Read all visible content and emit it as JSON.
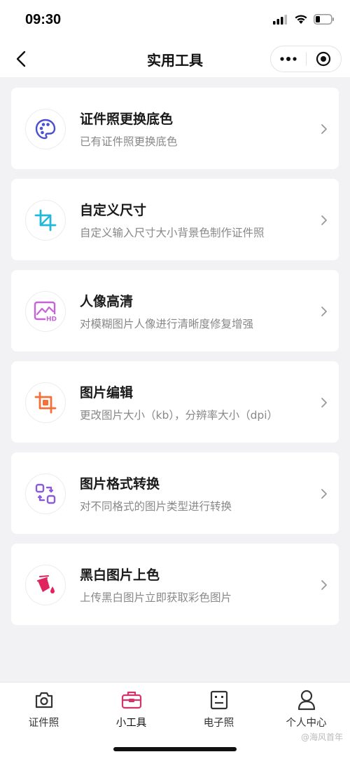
{
  "status_bar": {
    "time": "09:30"
  },
  "nav": {
    "title": "实用工具"
  },
  "tools": [
    {
      "title": "证件照更换底色",
      "desc": "已有证件照更换底色",
      "icon": "palette-icon",
      "color": "#4b4fd1"
    },
    {
      "title": "自定义尺寸",
      "desc": "自定义输入尺寸大小背景色制作证件照",
      "icon": "crop-icon",
      "color": "#22b8d8"
    },
    {
      "title": "人像高清",
      "desc": "对模糊图片人像进行清晰度修复增强",
      "icon": "hd-image-icon",
      "color": "#c763d8"
    },
    {
      "title": "图片编辑",
      "desc": "更改图片大小（kb），分辨率大小（dpi）",
      "icon": "crop-edit-icon",
      "color": "#f2703a"
    },
    {
      "title": "图片格式转换",
      "desc": "对不同格式的图片类型进行转换",
      "icon": "convert-icon",
      "color": "#8a5cd6"
    },
    {
      "title": "黑白图片上色",
      "desc": "上传黑白图片立即获取彩色图片",
      "icon": "paint-bucket-icon",
      "color": "#e0245e"
    }
  ],
  "tabs": [
    {
      "label": "证件照",
      "icon": "camera-icon",
      "active": false
    },
    {
      "label": "小工具",
      "icon": "toolbox-icon",
      "active": true,
      "color": "#d6336c"
    },
    {
      "label": "电子照",
      "icon": "id-photo-icon",
      "active": false
    },
    {
      "label": "个人中心",
      "icon": "user-icon",
      "active": false
    }
  ],
  "watermark": "@海风首年"
}
